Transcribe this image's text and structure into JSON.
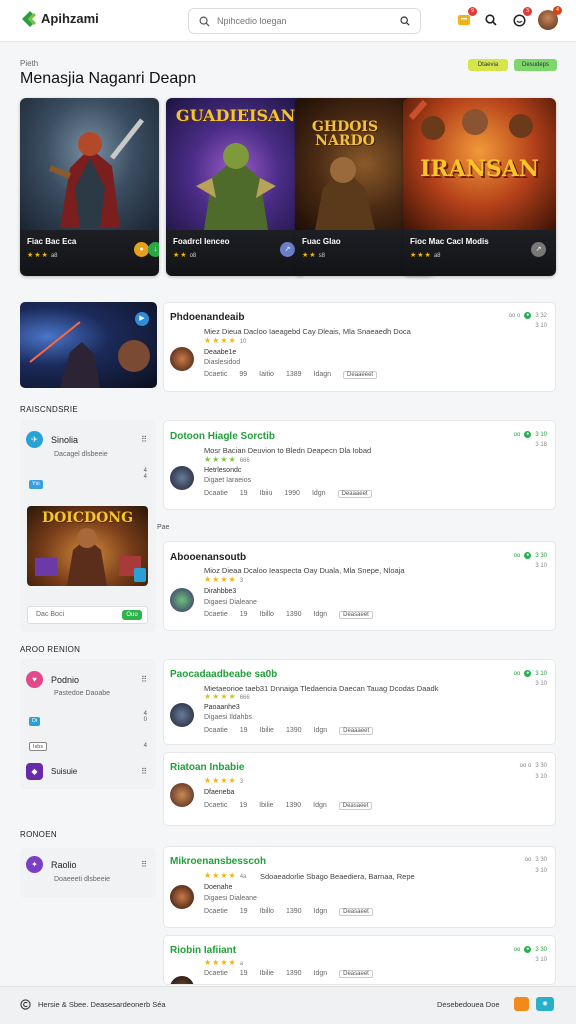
{
  "header": {
    "logo_text": "Apihzami",
    "logo_sub": "",
    "search_placeholder": "Npihcedio loegan",
    "notif_count": "9",
    "messages_count": "3",
    "updates_count": "4"
  },
  "page": {
    "breadcrumb": "Pieth",
    "title": "Menasjia Naganri Deapn",
    "pill_a": "Dtaevia",
    "pill_b": "Desudeps"
  },
  "featured": [
    {
      "art": "",
      "title": "Fiac Bac Eca",
      "rating": "a8",
      "btn_color": "#e6a019"
    },
    {
      "art": "GUADIEISAN",
      "title": "Foadrcl Ienceo",
      "rating": "o8",
      "btn_color": "#6b7fc7"
    },
    {
      "art": "GHDOIS\nNARDO",
      "title": "Fuac Glao",
      "rating": "s8",
      "btn_color": "#29a845"
    },
    {
      "art": "IRANSAN",
      "title": "Fioc Mac Cacl Modis",
      "rating": "a8",
      "btn_color": "#777777"
    }
  ],
  "cards": [
    {
      "title": "Phdoenandeaib",
      "desc": "Miez Dieua Dacloo Iaeagebd Cay Dleais, Mla Snaeaedh Doca",
      "rating": "10",
      "name": "Deaabe1e",
      "sub": "Diaslesidod",
      "meta": [
        "Dcaetic",
        "99",
        "Iaitio",
        "1389",
        "Idagn"
      ],
      "tag": "Deaaeeet",
      "right_a": "oo o",
      "right_b": "3 32",
      "right_c": "3 10",
      "title_color": "#222222"
    },
    {
      "title": "Dotoon Hiagle Sorctib",
      "desc": "Mosr Bacian Deuvion to Bledn Deapecn Dla Iobad",
      "rating": "666",
      "name": "Hetrlesondc",
      "sub": "Digaet Iaraeios",
      "meta": [
        "Dcaatie",
        "19",
        "Ibiiu",
        "1990",
        "Idgn"
      ],
      "tag": "Deaaaeet",
      "right_a": "oo",
      "right_b": "3 10",
      "right_c": "3 18",
      "title_color": "#21a038"
    },
    {
      "title": "Abooenansoutb",
      "desc": "Mioz Dieaa Dcaloo Ieaspecta Oay Duala, Mla Snepe, Nloaja",
      "rating": "3",
      "name": "Dirahbbe3",
      "sub": "Digaesi Dialeane",
      "meta": [
        "Dcaetie",
        "19",
        "Ibillo",
        "1390",
        "Idgn"
      ],
      "tag": "Deasaeet",
      "right_a": "oo",
      "right_b": "3 30",
      "right_c": "3 10",
      "title_color": "#222222"
    },
    {
      "title": "Paocadaadbeabe sa0b",
      "desc": "Mietaeorioe taeb31 Dnnaiga Tledaencia Daecan Tauag Dcodas Daadk",
      "rating": "666",
      "name": "Paoaanhe3",
      "sub": "Digaesi Ildahbs",
      "meta": [
        "Dcaatie",
        "19",
        "Ibilie",
        "1390",
        "Idgn"
      ],
      "tag": "Deaaaeet",
      "right_a": "oo",
      "right_b": "3 10",
      "right_c": "3 10",
      "title_color": "#21a038"
    },
    {
      "title": "Riatoan Inbabie",
      "desc": "",
      "rating": "3",
      "name": "Dfaeneba",
      "sub": "",
      "meta": [
        "Dcaetic",
        "19",
        "Ibilie",
        "1390",
        "Idgn"
      ],
      "tag": "Deasaeet",
      "right_a": "oo o",
      "right_b": "3 30",
      "right_c": "3 10",
      "title_color": "#21a038"
    },
    {
      "title": "Mikroenansbesscoh",
      "desc": "Sdoaeadorlie Sbago Beaediera, Barnaa, Repe",
      "rating": "4a",
      "name": "Doenahe",
      "sub": "Digaesi Dialeane",
      "meta": [
        "Dcaetie",
        "19",
        "Ibillo",
        "1390",
        "Idgn"
      ],
      "tag": "Deasaeet",
      "right_a": "oo",
      "right_b": "3 30",
      "right_c": "3 10",
      "title_color": "#21a038"
    },
    {
      "title": "Riobin Iafiiant",
      "desc": "",
      "rating": "a",
      "name": "",
      "sub": "",
      "meta": [
        "Dcaetie",
        "19",
        "Ibilie",
        "1390",
        "Idgn"
      ],
      "tag": "Deasaeet",
      "right_a": "oo",
      "right_b": "3 30",
      "right_c": "3 10",
      "title_color": "#21a038"
    }
  ],
  "sections": {
    "s1": "RAISCNDSRIE",
    "s2": "AROO RENION",
    "s3": "RONOEN",
    "mid_label": "Pae"
  },
  "side1": {
    "item_name": "Sinolia",
    "item_sub": "Dacagel dlsbeeie",
    "mini_a": "Ysi",
    "promo_title": "DOICDONG",
    "promo_input": "Dac Boci",
    "promo_btn": "Ouo"
  },
  "side2": {
    "item_name": "Podnio",
    "item_sub": "Pastedoe Daoabe",
    "mini_a": "Di",
    "mini_b": "Isbs",
    "item2_name": "Suisuie"
  },
  "side3": {
    "item_name": "Raolio",
    "item_sub": "Doaeeeti dlsbeeie"
  },
  "footer": {
    "left_text": "Hersie & Sbee. Deasesardeonerb Séa",
    "right_text": "Desebedouea Doe"
  }
}
